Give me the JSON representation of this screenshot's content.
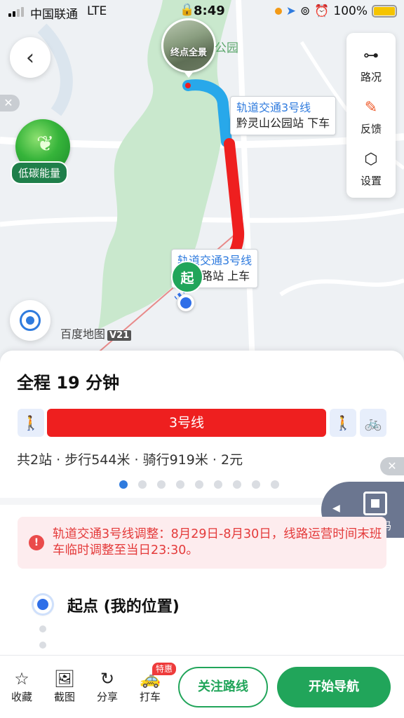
{
  "status_bar": {
    "carrier": "中国联通",
    "network": "LTE",
    "time": "8:49",
    "battery": "100%"
  },
  "map": {
    "endpoint_preview_label": "终点全景",
    "park_label": "公园",
    "low_carbon_label": "低碳能量",
    "side_panel": {
      "traffic": "路况",
      "feedback": "反馈",
      "settings": "设置"
    },
    "alight_callout": {
      "line": "轨道交通3号线",
      "station": "黔灵山公园站 下车"
    },
    "board_callout": {
      "line": "轨道交通3号线",
      "station": "路站 上车"
    },
    "start_marker": "起",
    "logo": "百度地图",
    "logo_version": "V21"
  },
  "sheet": {
    "title": "全程 19 分钟",
    "line_name": "3号线",
    "summary": "共2站 · 步行544米 · 骑行919米 · 2元",
    "page_count": 9,
    "active_page": 1,
    "ride_code_label": "乘车码",
    "notice": "轨道交通3号线调整：8月29日-8月30日，线路运营时间末班车临时调整至当日23:30。",
    "origin_label": "起点 (我的位置)"
  },
  "bottom_bar": {
    "favorite": "收藏",
    "screenshot": "截图",
    "share": "分享",
    "taxi": "打车",
    "taxi_badge": "特惠",
    "follow": "关注路线",
    "start_nav": "开始导航"
  },
  "colors": {
    "green": "#21a55a",
    "blue": "#2f7bde",
    "red_line": "#ee1f1f"
  }
}
